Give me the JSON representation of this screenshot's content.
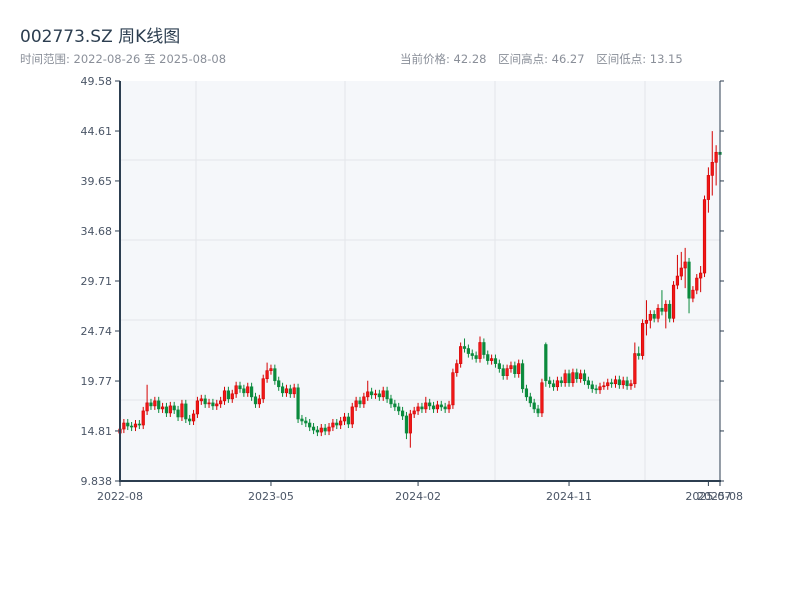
{
  "header": {
    "title": "002773.SZ 周K线图",
    "time_range": "时间范围: 2022-08-26 至 2025-08-08",
    "current_price": "当前价格: 42.28",
    "range_high": "区间高点: 46.27",
    "range_low": "区间低点: 13.15"
  },
  "chart_data": {
    "type": "candlestick",
    "title": "002773.SZ 周K线图",
    "frequency": "weekly",
    "start_date": "2022-08-26",
    "end_date": "2025-08-08",
    "ylim": [
      9.838,
      49.58
    ],
    "y_ticks": [
      "9.838",
      "14.81",
      "19.77",
      "24.74",
      "29.71",
      "34.68",
      "39.65",
      "44.61",
      "49.58"
    ],
    "x_ticks": [
      {
        "label": "2022-08",
        "index": 0
      },
      {
        "label": "2023-05",
        "index": 39
      },
      {
        "label": "2024-02",
        "index": 77
      },
      {
        "label": "2024-11",
        "index": 116
      },
      {
        "label": "2025-07",
        "index": 152
      },
      {
        "label": "2025-08",
        "index": 155
      }
    ],
    "grid": true,
    "colors": {
      "up": "#d40000",
      "down": "#0b8a3c",
      "background": "#f5f7fa",
      "axis": "#2c3e50",
      "grid": "#e3e6ea"
    },
    "ohlc_order": [
      "open",
      "high",
      "low",
      "close"
    ],
    "ohlc": [
      [
        14.6,
        15.4,
        14.2,
        15.0
      ],
      [
        15.0,
        16.0,
        14.6,
        15.6
      ],
      [
        15.6,
        16.0,
        14.9,
        15.3
      ],
      [
        15.3,
        15.7,
        14.8,
        15.2
      ],
      [
        15.2,
        15.9,
        14.8,
        15.5
      ],
      [
        15.5,
        15.9,
        15.0,
        15.4
      ],
      [
        15.4,
        17.2,
        15.0,
        16.8
      ],
      [
        16.8,
        19.4,
        16.4,
        17.6
      ],
      [
        17.6,
        18.0,
        16.9,
        17.3
      ],
      [
        17.3,
        18.2,
        16.9,
        17.8
      ],
      [
        17.8,
        18.2,
        16.6,
        17.0
      ],
      [
        17.0,
        17.6,
        16.6,
        17.2
      ],
      [
        17.2,
        17.6,
        16.2,
        16.6
      ],
      [
        16.6,
        17.7,
        16.2,
        17.3
      ],
      [
        17.3,
        17.7,
        16.5,
        16.9
      ],
      [
        16.9,
        17.3,
        15.8,
        16.2
      ],
      [
        16.2,
        17.9,
        15.8,
        17.5
      ],
      [
        17.5,
        17.9,
        15.6,
        16.0
      ],
      [
        16.0,
        16.4,
        15.4,
        15.8
      ],
      [
        15.8,
        16.9,
        15.4,
        16.5
      ],
      [
        16.5,
        18.2,
        16.1,
        17.8
      ],
      [
        17.8,
        18.4,
        17.4,
        18.0
      ],
      [
        18.0,
        18.4,
        17.1,
        17.5
      ],
      [
        17.5,
        18.0,
        17.1,
        17.6
      ],
      [
        17.6,
        18.0,
        16.9,
        17.3
      ],
      [
        17.3,
        17.9,
        16.9,
        17.5
      ],
      [
        17.5,
        18.2,
        17.1,
        17.8
      ],
      [
        17.8,
        19.2,
        17.4,
        18.8
      ],
      [
        18.8,
        19.2,
        17.6,
        18.0
      ],
      [
        18.0,
        18.9,
        17.6,
        18.5
      ],
      [
        18.5,
        19.7,
        18.1,
        19.3
      ],
      [
        19.3,
        19.7,
        18.6,
        19.0
      ],
      [
        19.0,
        19.4,
        18.2,
        18.6
      ],
      [
        18.6,
        19.6,
        18.2,
        19.2
      ],
      [
        19.2,
        19.6,
        17.8,
        18.2
      ],
      [
        18.2,
        18.6,
        17.1,
        17.5
      ],
      [
        17.5,
        18.4,
        17.1,
        18.0
      ],
      [
        18.0,
        20.4,
        17.6,
        20.0
      ],
      [
        20.0,
        21.6,
        19.6,
        20.8
      ],
      [
        20.8,
        21.4,
        20.4,
        21.0
      ],
      [
        21.0,
        21.4,
        19.4,
        19.8
      ],
      [
        19.8,
        20.2,
        18.8,
        19.2
      ],
      [
        19.2,
        19.6,
        18.2,
        18.6
      ],
      [
        18.6,
        19.4,
        18.2,
        19.0
      ],
      [
        19.0,
        19.4,
        18.1,
        18.5
      ],
      [
        18.5,
        19.5,
        18.1,
        19.1
      ],
      [
        19.1,
        19.5,
        15.6,
        16.0
      ],
      [
        16.0,
        16.4,
        15.4,
        15.8
      ],
      [
        15.8,
        16.2,
        15.2,
        15.6
      ],
      [
        15.6,
        16.0,
        14.8,
        15.2
      ],
      [
        15.2,
        15.6,
        14.5,
        14.9
      ],
      [
        14.9,
        15.3,
        14.3,
        14.7
      ],
      [
        14.7,
        15.5,
        14.3,
        15.1
      ],
      [
        15.1,
        15.5,
        14.4,
        14.8
      ],
      [
        14.8,
        15.6,
        14.4,
        15.2
      ],
      [
        15.2,
        16.0,
        14.8,
        15.6
      ],
      [
        15.6,
        16.0,
        15.0,
        15.4
      ],
      [
        15.4,
        16.2,
        15.0,
        15.8
      ],
      [
        15.8,
        16.6,
        15.4,
        16.2
      ],
      [
        16.2,
        16.6,
        15.1,
        15.5
      ],
      [
        15.5,
        17.6,
        15.1,
        17.2
      ],
      [
        17.2,
        18.2,
        16.8,
        17.8
      ],
      [
        17.8,
        18.2,
        17.1,
        17.5
      ],
      [
        17.5,
        18.6,
        17.1,
        18.2
      ],
      [
        18.2,
        19.8,
        17.8,
        18.7
      ],
      [
        18.7,
        19.1,
        18.0,
        18.4
      ],
      [
        18.4,
        18.9,
        18.0,
        18.5
      ],
      [
        18.5,
        18.9,
        17.8,
        18.2
      ],
      [
        18.2,
        19.2,
        17.8,
        18.8
      ],
      [
        18.8,
        19.2,
        17.6,
        18.0
      ],
      [
        18.0,
        18.4,
        17.1,
        17.5
      ],
      [
        17.5,
        17.9,
        16.8,
        17.2
      ],
      [
        17.2,
        17.6,
        16.4,
        16.8
      ],
      [
        16.8,
        17.2,
        15.9,
        16.3
      ],
      [
        16.3,
        16.7,
        14.0,
        14.6
      ],
      [
        14.6,
        16.9,
        13.15,
        16.5
      ],
      [
        16.5,
        17.2,
        16.1,
        16.8
      ],
      [
        16.8,
        17.6,
        16.4,
        17.2
      ],
      [
        17.2,
        17.6,
        16.6,
        17.0
      ],
      [
        17.0,
        18.2,
        16.6,
        17.6
      ],
      [
        17.6,
        18.0,
        16.9,
        17.3
      ],
      [
        17.3,
        17.7,
        16.6,
        17.0
      ],
      [
        17.0,
        17.8,
        16.6,
        17.4
      ],
      [
        17.4,
        17.8,
        16.8,
        17.2
      ],
      [
        17.2,
        17.6,
        16.6,
        17.0
      ],
      [
        17.0,
        17.8,
        16.6,
        17.4
      ],
      [
        17.4,
        21.0,
        17.0,
        20.6
      ],
      [
        20.6,
        21.9,
        20.2,
        21.5
      ],
      [
        21.5,
        23.6,
        21.1,
        23.2
      ],
      [
        23.2,
        24.0,
        22.6,
        23.0
      ],
      [
        23.0,
        23.4,
        22.1,
        22.5
      ],
      [
        22.5,
        22.9,
        21.9,
        22.3
      ],
      [
        22.3,
        22.7,
        21.6,
        22.0
      ],
      [
        22.0,
        24.2,
        21.6,
        23.6
      ],
      [
        23.6,
        24.0,
        22.0,
        22.4
      ],
      [
        22.4,
        22.8,
        21.4,
        21.8
      ],
      [
        21.8,
        22.4,
        21.4,
        22.0
      ],
      [
        22.0,
        22.4,
        21.1,
        21.5
      ],
      [
        21.5,
        21.9,
        20.6,
        21.0
      ],
      [
        21.0,
        21.4,
        19.9,
        20.3
      ],
      [
        20.3,
        21.4,
        19.9,
        21.0
      ],
      [
        21.0,
        21.7,
        20.6,
        21.3
      ],
      [
        21.3,
        21.7,
        20.1,
        20.5
      ],
      [
        20.5,
        21.9,
        20.1,
        21.5
      ],
      [
        21.5,
        21.9,
        18.6,
        19.0
      ],
      [
        19.0,
        19.4,
        17.8,
        18.2
      ],
      [
        18.2,
        18.6,
        17.2,
        17.6
      ],
      [
        17.6,
        18.0,
        16.6,
        17.0
      ],
      [
        17.0,
        17.4,
        16.2,
        16.6
      ],
      [
        16.6,
        20.0,
        16.2,
        19.6
      ],
      [
        23.4,
        23.6,
        19.2,
        19.8
      ],
      [
        19.8,
        20.2,
        19.1,
        19.5
      ],
      [
        19.5,
        19.9,
        18.8,
        19.2
      ],
      [
        19.2,
        20.2,
        18.8,
        19.8
      ],
      [
        19.8,
        20.2,
        19.2,
        19.6
      ],
      [
        19.6,
        20.9,
        19.2,
        20.5
      ],
      [
        20.5,
        20.9,
        19.2,
        19.6
      ],
      [
        19.6,
        21.0,
        19.2,
        20.6
      ],
      [
        20.6,
        21.0,
        19.6,
        20.0
      ],
      [
        20.0,
        20.9,
        19.6,
        20.5
      ],
      [
        20.5,
        20.9,
        19.4,
        19.8
      ],
      [
        19.8,
        20.2,
        19.0,
        19.4
      ],
      [
        19.4,
        19.8,
        18.6,
        19.0
      ],
      [
        19.0,
        19.4,
        18.5,
        18.9
      ],
      [
        18.9,
        19.6,
        18.5,
        19.2
      ],
      [
        19.2,
        19.7,
        18.9,
        19.3
      ],
      [
        19.3,
        20.0,
        18.9,
        19.6
      ],
      [
        19.6,
        20.0,
        19.1,
        19.5
      ],
      [
        19.5,
        20.3,
        19.1,
        19.9
      ],
      [
        19.9,
        20.3,
        19.0,
        19.4
      ],
      [
        19.4,
        20.2,
        19.0,
        19.8
      ],
      [
        19.8,
        20.2,
        18.9,
        19.3
      ],
      [
        19.3,
        19.9,
        18.9,
        19.5
      ],
      [
        19.5,
        23.6,
        19.1,
        22.5
      ],
      [
        22.5,
        23.2,
        21.9,
        22.3
      ],
      [
        22.3,
        25.9,
        21.9,
        25.5
      ],
      [
        25.5,
        27.8,
        24.3,
        25.8
      ],
      [
        25.8,
        26.8,
        25.0,
        26.4
      ],
      [
        26.4,
        26.8,
        25.6,
        26.0
      ],
      [
        26.0,
        27.4,
        25.6,
        27.0
      ],
      [
        27.0,
        28.8,
        26.3,
        26.7
      ],
      [
        26.7,
        27.8,
        25.0,
        27.4
      ],
      [
        27.4,
        27.8,
        25.6,
        26.0
      ],
      [
        26.0,
        29.7,
        25.6,
        29.3
      ],
      [
        29.3,
        32.3,
        28.9,
        30.2
      ],
      [
        30.2,
        32.6,
        29.8,
        31.0
      ],
      [
        31.0,
        33.0,
        29.0,
        31.6
      ],
      [
        31.6,
        32.0,
        26.5,
        28.0
      ],
      [
        28.0,
        29.2,
        27.6,
        28.8
      ],
      [
        28.8,
        30.4,
        28.4,
        30.0
      ],
      [
        30.0,
        31.2,
        28.6,
        30.5
      ],
      [
        30.5,
        38.2,
        30.1,
        37.8
      ],
      [
        37.8,
        41.0,
        36.5,
        40.2
      ],
      [
        40.2,
        44.6,
        38.2,
        41.5
      ],
      [
        41.5,
        43.2,
        39.2,
        42.5
      ],
      [
        42.5,
        46.27,
        42.0,
        42.28
      ]
    ]
  }
}
